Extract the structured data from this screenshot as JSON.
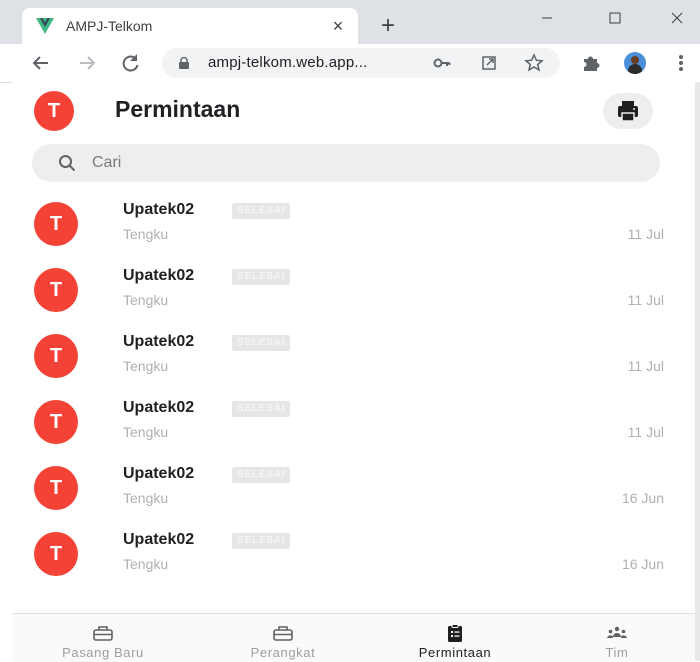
{
  "browser": {
    "tab_title": "AMPJ-Telkom",
    "tab_close": "×",
    "new_tab": "+",
    "url": "ampj-telkom.web.app...",
    "back_icon": "arrow-left",
    "forward_icon": "arrow-right",
    "reload_icon": "reload",
    "key_icon": "key",
    "open_in_app_icon": "external-link",
    "bookmark_icon": "star",
    "extensions_icon": "puzzle",
    "menu_icon": "kebab-menu"
  },
  "header": {
    "avatar_letter": "T",
    "title": "Permintaan",
    "print_icon": "printer"
  },
  "search": {
    "placeholder": "Cari",
    "value": ""
  },
  "requests": [
    {
      "avatar": "T",
      "title": "Upatek02",
      "badge": "SELESAI",
      "subtitle": "Tengku",
      "date": "11 Jul"
    },
    {
      "avatar": "T",
      "title": "Upatek02",
      "badge": "SELESAI",
      "subtitle": "Tengku",
      "date": "11 Jul"
    },
    {
      "avatar": "T",
      "title": "Upatek02",
      "badge": "SELESAI",
      "subtitle": "Tengku",
      "date": "11 Jul"
    },
    {
      "avatar": "T",
      "title": "Upatek02",
      "badge": "SELESAI",
      "subtitle": "Tengku",
      "date": "11 Jul"
    },
    {
      "avatar": "T",
      "title": "Upatek02",
      "badge": "SELESAI",
      "subtitle": "Tengku",
      "date": "16 Jun"
    },
    {
      "avatar": "T",
      "title": "Upatek02",
      "badge": "SELESAI",
      "subtitle": "Tengku",
      "date": "16 Jun"
    }
  ],
  "bottom_nav": [
    {
      "label": "Pasang Baru",
      "icon": "toolbox",
      "active": false
    },
    {
      "label": "Perangkat",
      "icon": "toolbox",
      "active": false
    },
    {
      "label": "Permintaan",
      "icon": "clipboard-list",
      "active": true
    },
    {
      "label": "Tim",
      "icon": "people-group",
      "active": false
    }
  ],
  "colors": {
    "accent": "#f44336",
    "badge_bg": "#e6e6e6",
    "secondary_text": "#b0b0b0"
  }
}
